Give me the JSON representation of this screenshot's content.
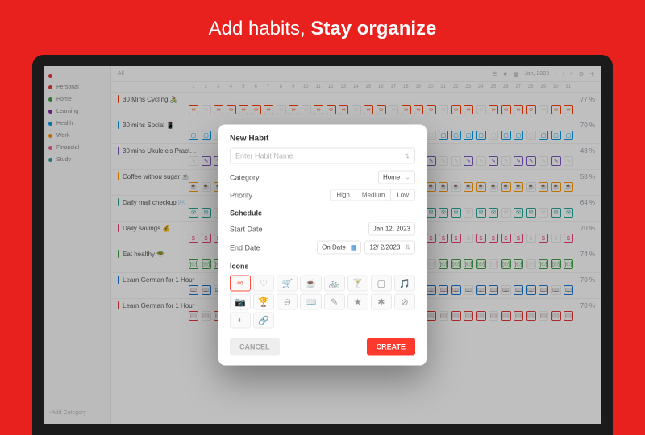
{
  "hero": {
    "light": "Add habits, ",
    "bold": "Stay organize"
  },
  "sidebar": {
    "items": [
      {
        "label": "",
        "color": "#e53935"
      },
      {
        "label": "Personal",
        "color": "#e53935"
      },
      {
        "label": "Home",
        "color": "#43a047"
      },
      {
        "label": "Learning",
        "color": "#8e24aa"
      },
      {
        "label": "Health",
        "color": "#039be5"
      },
      {
        "label": "Work",
        "color": "#ff8f00"
      },
      {
        "label": "Financial",
        "color": "#f06292"
      },
      {
        "label": "Study",
        "color": "#26a69a"
      }
    ],
    "add": "+Add Category"
  },
  "topbar": {
    "left": "All",
    "month": "Jan, 2023",
    "icons": [
      "list",
      "star",
      "calendar",
      "left",
      "right",
      "search",
      "gear",
      "plus"
    ]
  },
  "days": [
    "1",
    "2",
    "3",
    "4",
    "5",
    "6",
    "7",
    "8",
    "9",
    "10",
    "11",
    "12",
    "13",
    "14",
    "15",
    "16",
    "17",
    "18",
    "19",
    "20",
    "21",
    "22",
    "23",
    "24",
    "25",
    "26",
    "27",
    "28",
    "29",
    "30",
    "31"
  ],
  "habits": [
    {
      "name": "30 Mins Cycling 🚴",
      "pct": "77 %",
      "color": "#ff3d00",
      "glyph": "∞"
    },
    {
      "name": "30 mins Social 📱",
      "pct": "70 %",
      "color": "#039be5",
      "glyph": "▢"
    },
    {
      "name": "30 mins Ukulele's Pract…",
      "pct": "48 %",
      "color": "#7e57c2",
      "glyph": "✎"
    },
    {
      "name": "Coffee withou sugar ☕",
      "pct": "58 %",
      "color": "#ff9800",
      "glyph": "☕"
    },
    {
      "name": "Daily mail checkup ✉️",
      "pct": "64 %",
      "color": "#26a69a",
      "glyph": "✉"
    },
    {
      "name": "Daily savings 💰",
      "pct": "70 %",
      "color": "#ec407a",
      "glyph": "$"
    },
    {
      "name": "Eat healthy 🥗",
      "pct": "74 %",
      "color": "#43a047",
      "glyph": "🍽"
    },
    {
      "name": "Learn German for 1 Hour",
      "pct": "70 %",
      "color": "#1976d2",
      "glyph": "📖"
    },
    {
      "name": "Learn German for 1 Hour",
      "pct": "70 %",
      "color": "#e53935",
      "glyph": "📖"
    }
  ],
  "patterns": [
    [
      1,
      0,
      1,
      1,
      1,
      1,
      1,
      0,
      1,
      0,
      1,
      1,
      1,
      0,
      1,
      1,
      0,
      1,
      1,
      1,
      0,
      1,
      1,
      0,
      1,
      1,
      1,
      1,
      0,
      1,
      1
    ],
    [
      1,
      1,
      0,
      1,
      0,
      1,
      1,
      1,
      1,
      0,
      1,
      0,
      1,
      1,
      0,
      1,
      1,
      1,
      1,
      0,
      1,
      1,
      1,
      1,
      0,
      1,
      1,
      0,
      1,
      1,
      1
    ],
    [
      0,
      1,
      1,
      0,
      1,
      0,
      1,
      1,
      0,
      0,
      1,
      0,
      1,
      0,
      0,
      1,
      1,
      0,
      1,
      1,
      0,
      0,
      1,
      0,
      1,
      0,
      1,
      1,
      0,
      1,
      0
    ],
    [
      1,
      0,
      1,
      1,
      0,
      1,
      1,
      0,
      1,
      1,
      0,
      1,
      1,
      1,
      0,
      0,
      1,
      1,
      0,
      1,
      1,
      0,
      1,
      1,
      0,
      1,
      1,
      0,
      1,
      1,
      1
    ],
    [
      1,
      1,
      0,
      1,
      1,
      1,
      0,
      1,
      0,
      1,
      1,
      0,
      1,
      1,
      1,
      1,
      0,
      1,
      0,
      1,
      1,
      1,
      0,
      1,
      1,
      0,
      1,
      1,
      0,
      1,
      1
    ],
    [
      1,
      1,
      1,
      0,
      1,
      1,
      1,
      0,
      1,
      1,
      0,
      1,
      1,
      1,
      1,
      0,
      1,
      1,
      0,
      1,
      1,
      1,
      0,
      1,
      1,
      1,
      1,
      0,
      1,
      0,
      1
    ],
    [
      1,
      1,
      1,
      1,
      0,
      1,
      0,
      1,
      1,
      1,
      1,
      0,
      1,
      1,
      1,
      0,
      1,
      1,
      1,
      0,
      1,
      1,
      1,
      1,
      0,
      1,
      1,
      0,
      1,
      1,
      1
    ],
    [
      1,
      1,
      0,
      1,
      1,
      1,
      1,
      0,
      1,
      1,
      1,
      0,
      1,
      0,
      1,
      1,
      1,
      1,
      0,
      1,
      1,
      1,
      0,
      1,
      1,
      0,
      1,
      1,
      1,
      0,
      1
    ],
    [
      1,
      0,
      1,
      1,
      0,
      1,
      1,
      1,
      1,
      0,
      1,
      1,
      0,
      1,
      1,
      0,
      1,
      1,
      1,
      1,
      0,
      1,
      1,
      1,
      0,
      1,
      1,
      1,
      0,
      1,
      1
    ]
  ],
  "modal": {
    "title": "New Habit",
    "placeholder": "Enter Habit Name",
    "category_label": "Category",
    "category_value": "Home",
    "priority_label": "Priority",
    "priority_opts": [
      "High",
      "Medium",
      "Low"
    ],
    "schedule_label": "Schedule",
    "start_label": "Start Date",
    "start_value": "Jan 12, 2023",
    "end_label": "End Date",
    "end_mode": "On Date",
    "end_value": "12/ 2/2023",
    "icons_label": "Icons",
    "icons": [
      "∞",
      "♡",
      "🛒",
      "☕",
      "🚲",
      "🍸",
      "▢",
      "🎵",
      "📷",
      "🏆",
      "⊖",
      "📖",
      "✎",
      "★",
      "✱",
      "⊘",
      "◐",
      "🔗"
    ],
    "selected_icon_index": 0,
    "cancel": "CANCEL",
    "create": "CREATE"
  }
}
